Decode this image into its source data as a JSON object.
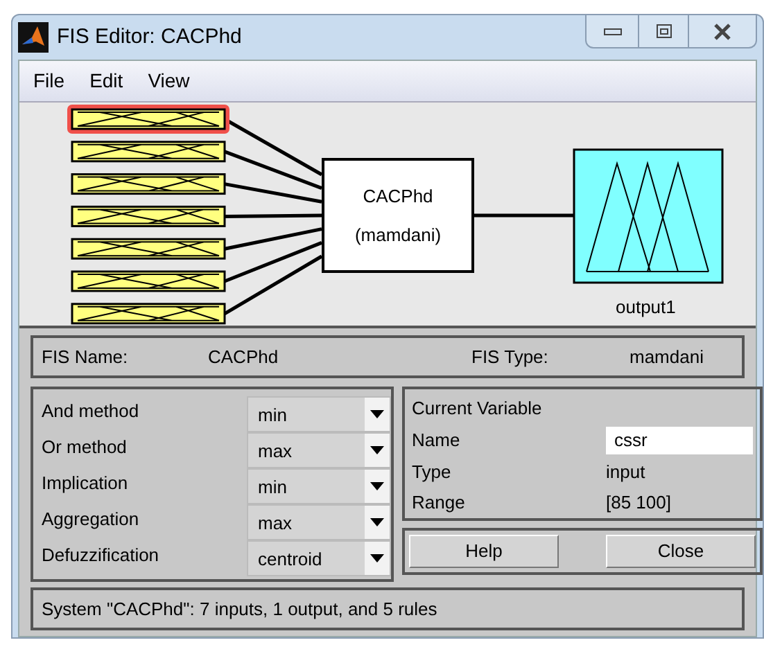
{
  "window": {
    "title": "FIS Editor: CACPhd"
  },
  "menu": [
    "File",
    "Edit",
    "View"
  ],
  "diagram": {
    "inputs": [
      {
        "selected": true
      },
      {
        "selected": false
      },
      {
        "selected": false
      },
      {
        "selected": false
      },
      {
        "selected": false
      },
      {
        "selected": false
      },
      {
        "selected": false
      }
    ],
    "system": {
      "name": "CACPhd",
      "type": "(mamdani)"
    },
    "output": {
      "label": "output1"
    }
  },
  "fis_info": {
    "name_label": "FIS Name:",
    "name": "CACPhd",
    "type_label": "FIS Type:",
    "type": "mamdani"
  },
  "methods": [
    {
      "label": "And method",
      "value": "min"
    },
    {
      "label": "Or method",
      "value": "max"
    },
    {
      "label": "Implication",
      "value": "min"
    },
    {
      "label": "Aggregation",
      "value": "max"
    },
    {
      "label": "Defuzzification",
      "value": "centroid"
    }
  ],
  "current_variable": {
    "heading": "Current Variable",
    "name_label": "Name",
    "name": "cssr",
    "type_label": "Type",
    "type": "input",
    "range_label": "Range",
    "range": "[85 100]"
  },
  "buttons": [
    "Help",
    "Close"
  ],
  "status": "System \"CACPhd\": 7 inputs, 1 output, and 5 rules"
}
